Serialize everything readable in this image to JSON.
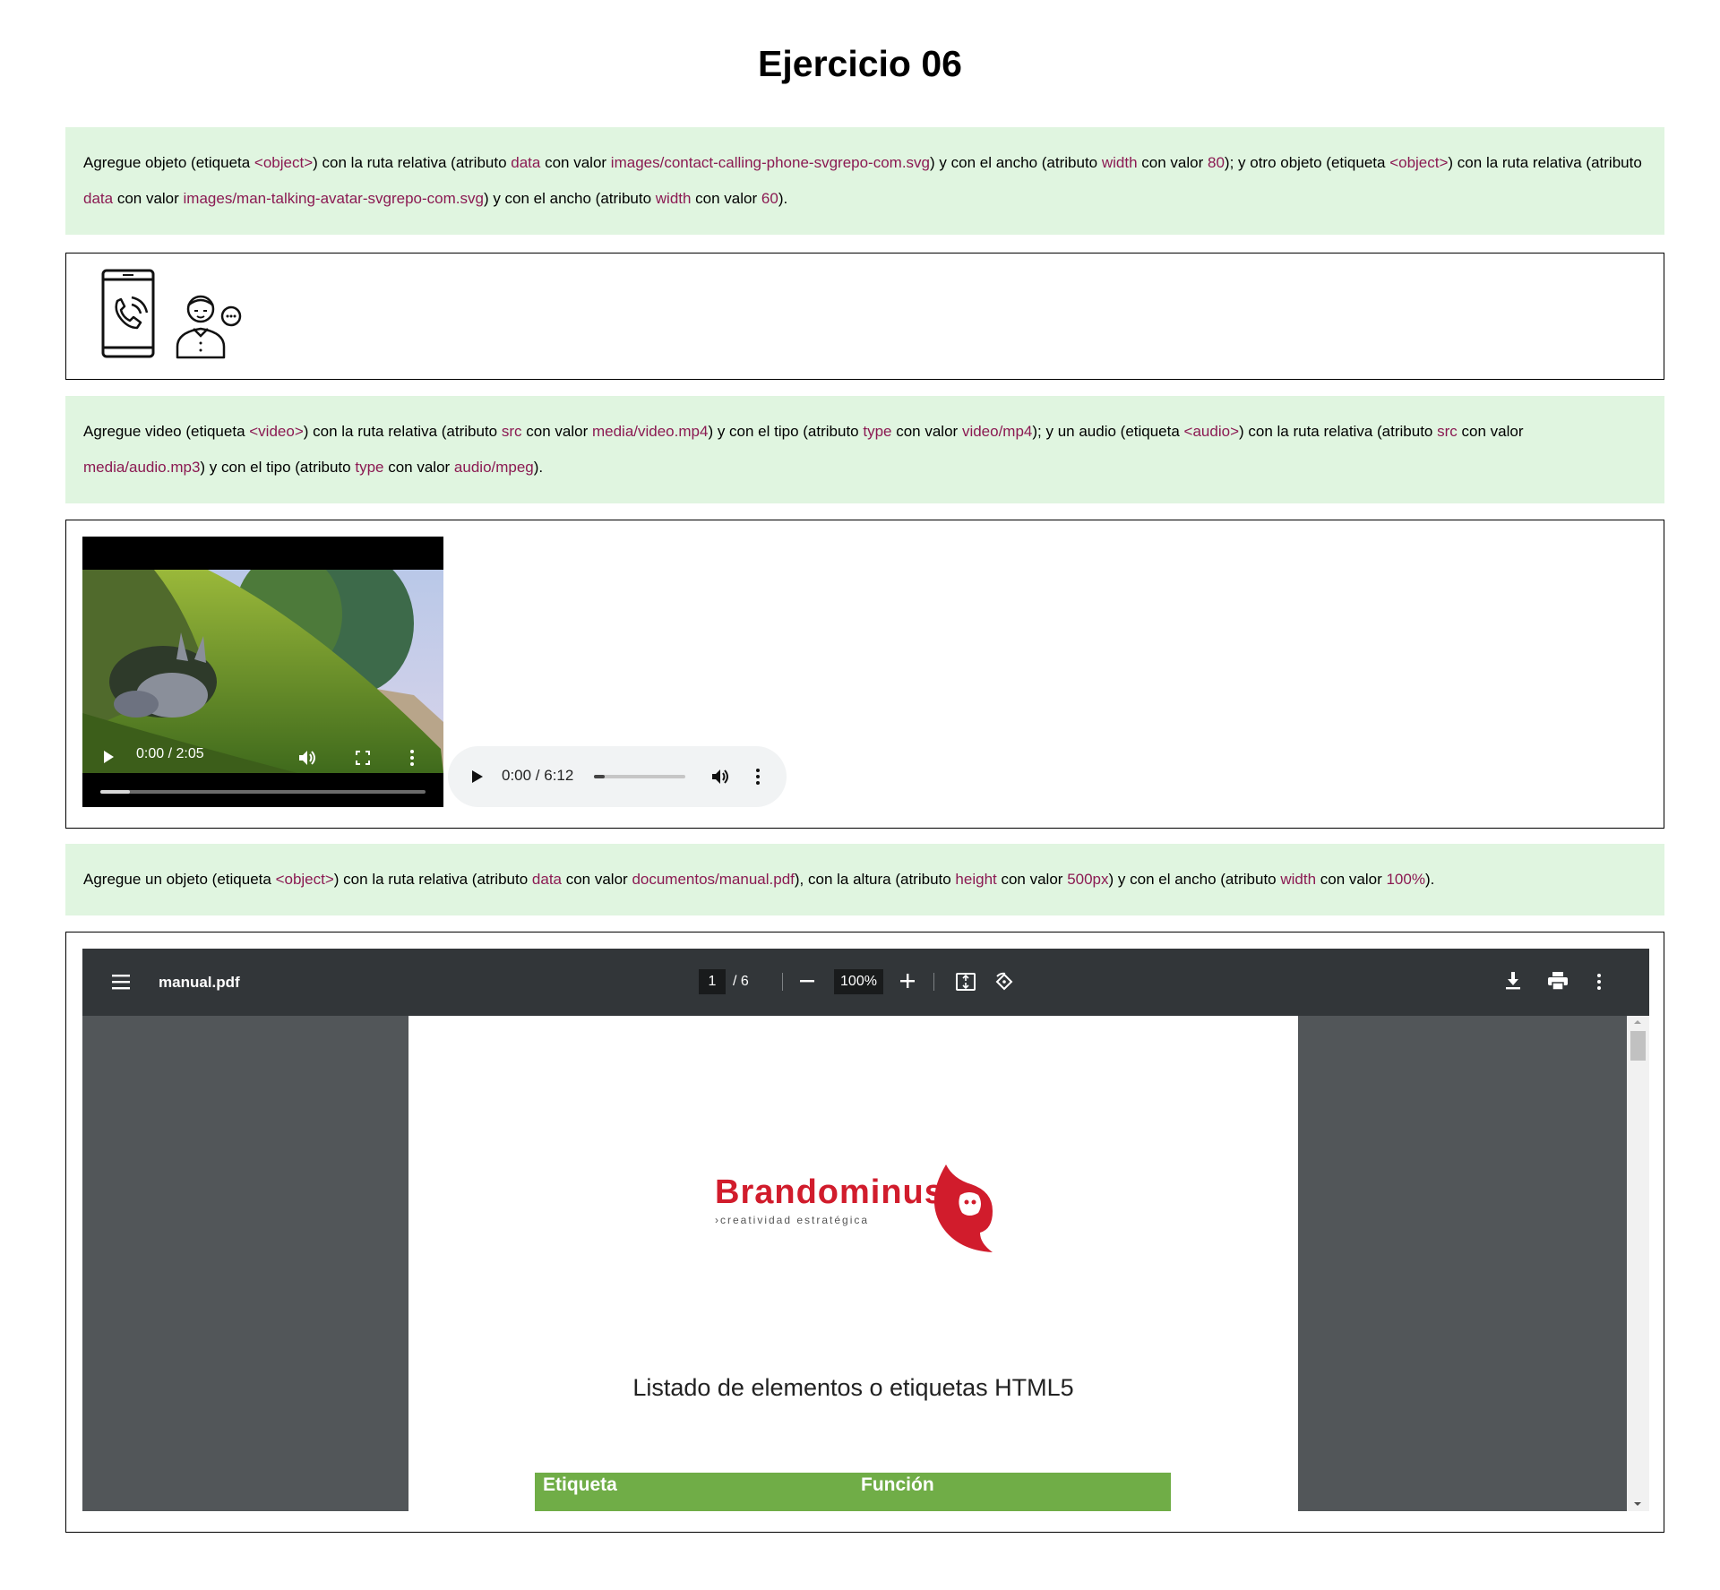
{
  "page_title": "Ejercicio 06",
  "note1": {
    "t1": "Agregue objeto (etiqueta ",
    "k1": "<object>",
    "t2": ") con la ruta relativa (atributo ",
    "k2": "data",
    "t3": " con valor ",
    "k3": "images/contact-calling-phone-svgrepo-com.svg",
    "t4": ") y con el ancho (atributo ",
    "k4": "width",
    "t5": " con valor ",
    "k5": "80",
    "t6": "); y otro objeto (etiqueta ",
    "k6": "<object>",
    "t7": ") con la ruta relativa (atributo ",
    "k7": "data",
    "t8": " con valor ",
    "k8": "images/man-talking-avatar-svgrepo-com.svg",
    "t9": ") y con el ancho (atributo ",
    "k9": "width",
    "t10": " con valor ",
    "k10": "60",
    "t11": ")."
  },
  "note2": {
    "t1": "Agregue video (etiqueta ",
    "k1": "<video>",
    "t2": ") con la ruta relativa (atributo ",
    "k2": "src",
    "t3": " con valor ",
    "k3": "media/video.mp4",
    "t4": ") y con el tipo (atributo ",
    "k4": "type",
    "t5": " con valor ",
    "k5": "video/mp4",
    "t6": "); y un audio (etiqueta ",
    "k6": "<audio>",
    "t7": ") con la ruta relativa (atributo ",
    "k7": "src",
    "t8": " con valor ",
    "k8": "media/audio.mp3",
    "t9": ") y con el tipo (atributo ",
    "k9": "type",
    "t10": " con valor ",
    "k10": "audio/mpeg",
    "t11": ")."
  },
  "note3": {
    "t1": "Agregue un objeto (etiqueta ",
    "k1": "<object>",
    "t2": ") con la ruta relativa (atributo ",
    "k2": "data",
    "t3": " con valor ",
    "k3": "documentos/manual.pdf",
    "t4": "), con la altura (atributo ",
    "k4": "height",
    "t5": " con valor ",
    "k5": "500px",
    "t6": ") y con el ancho (atributo ",
    "k6": "width",
    "t7": " con valor ",
    "k7": "100%",
    "t8": ")."
  },
  "icons": [
    "phone-call-icon",
    "man-talking-avatar-icon"
  ],
  "video": {
    "time": "0:00 / 2:05",
    "progress": 0.09
  },
  "audio": {
    "time": "0:00 / 6:12",
    "progress": 0.12
  },
  "pdf": {
    "filename": "manual.pdf",
    "page_current": "1",
    "page_total": "/ 6",
    "zoom": "100%",
    "logo_word": "Brandominus",
    "logo_tagline": "›creatividad estratégica",
    "heading": "Listado de elementos o etiquetas HTML5",
    "table_headers": [
      "Etiqueta",
      "Función"
    ]
  },
  "colors": {
    "keyword": "#8b1a52",
    "note_bg": "#e0f5e0",
    "pdf_toolbar": "#323639",
    "pdf_bg": "#525659",
    "table_header": "#70ad47",
    "logo_red": "#d11c2c"
  }
}
